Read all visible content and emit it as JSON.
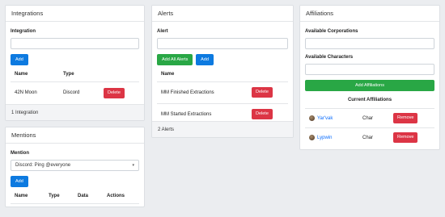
{
  "integrations": {
    "title": "Integrations",
    "field_label": "Integration",
    "input_value": "",
    "add_label": "Add",
    "columns": [
      "Name",
      "Type",
      ""
    ],
    "rows": [
      {
        "name": "42N Moon",
        "type": "Discord",
        "action": "Delete"
      }
    ],
    "footer": "1 Integration"
  },
  "mentions": {
    "title": "Mentions",
    "field_label": "Mention",
    "selected": "Discord: Ping @everyone",
    "add_label": "Add",
    "columns": [
      "Name",
      "Type",
      "Data",
      "Actions"
    ]
  },
  "alerts": {
    "title": "Alerts",
    "field_label": "Alert",
    "input_value": "",
    "add_all_label": "Add All Alerts",
    "add_label": "Add",
    "columns": [
      "Name",
      ""
    ],
    "rows": [
      {
        "name": "MM Finished Extractions",
        "action": "Delete"
      },
      {
        "name": "MM Started Extractions",
        "action": "Delete"
      }
    ],
    "footer": "2 Alerts"
  },
  "affiliations": {
    "title": "Affiliations",
    "corp_label": "Available Corporations",
    "corp_value": "",
    "char_label": "Available Characters",
    "char_value": "",
    "add_label": "Add Affiliations",
    "current_title": "Current Affiliations",
    "rows": [
      {
        "name": "Yar'vak",
        "type": "Char",
        "action": "Remove"
      },
      {
        "name": "Lypwin",
        "type": "Char",
        "action": "Remove"
      }
    ]
  },
  "colors": {
    "primary": "#0d7ae0",
    "success": "#29a745",
    "danger": "#dc3545",
    "link": "#0d6efd"
  }
}
